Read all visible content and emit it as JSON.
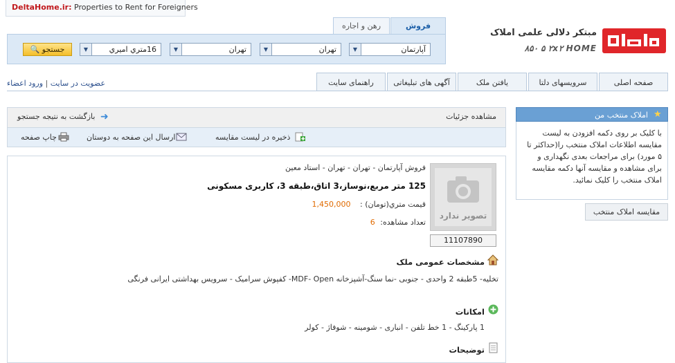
{
  "banner": {
    "site": "DeltaHome.ir:",
    "text": "Properties to Rent for Foreigners"
  },
  "logo": {
    "title": "مبتکر دلالی علمی املاک",
    "phone": "۸۵۰ ۵ ۲x۲ HOME"
  },
  "search": {
    "tabs": [
      "فروش",
      "رهن و اجاره"
    ],
    "selects": [
      "آپارتمان",
      "تهران",
      "تهران",
      "16متري اميري"
    ],
    "button": "جستجو"
  },
  "login": {
    "login": "ورود اعضاء",
    "separator": "|",
    "register": "عضويت در سايت"
  },
  "nav": [
    "صفحه اصلی",
    "سرویسهای دلتا",
    "یافتن ملک",
    "آگهی های تبلیغاتی",
    "راهنمای سایت"
  ],
  "sidebar": {
    "title": "املاک منتخب من",
    "body": "با کلیک بر روی دکمه افزودن به لیست مقایسه اطلاعات املاک منتخب را(حداکثر تا ۵ مورد) برای مراجعات بعدی نگهداری و برای مشاهده و مقایسه آنها دکمه مقایسه املاک منتخب را کلیک نمائید.",
    "button": "مقایسه املاک منتخب"
  },
  "detail": {
    "header": "مشاهده جزئیات",
    "back": "بازگشت به نتیجه جستجو",
    "save_compare": "ذخیره در لیست مقایسه",
    "send_friends": "ارسال این صفحه به دوستان",
    "print": "چاپ صفحه"
  },
  "property": {
    "photo_text": "تصویر ندارد",
    "code": "11107890",
    "breadcrumb": "فروش آپارتمان - تهران - تهران - استاد معین",
    "title": "125 متر مربع،نوساز،3 اتاق،طبقه 3، کاربری مسکونی",
    "price_label": "قیمت متري(تومان) :",
    "price_value": "1,450,000",
    "views_label": "تعداد مشاهده:",
    "views_value": "6"
  },
  "sections": {
    "general_title": "مشخصات عمومی ملک",
    "general_text": "تخلیه- 5طبقه 2 واحدی - جنوبی -نما سنگ-آشپزخانه MDF- Open- کفپوش سرامیک - سرویس بهداشتی ایرانی فرنگی",
    "amenities_title": "امکانات",
    "amenities_text": "1 پارکینگ - 1 خط تلفن - انباری - شومینه - شوفاژ - کولر",
    "desc_title": "توضیحات"
  },
  "colors": {
    "brand_red": "#e0262a",
    "accent_blue": "#6aa0d4",
    "price_orange": "#e06a00"
  }
}
